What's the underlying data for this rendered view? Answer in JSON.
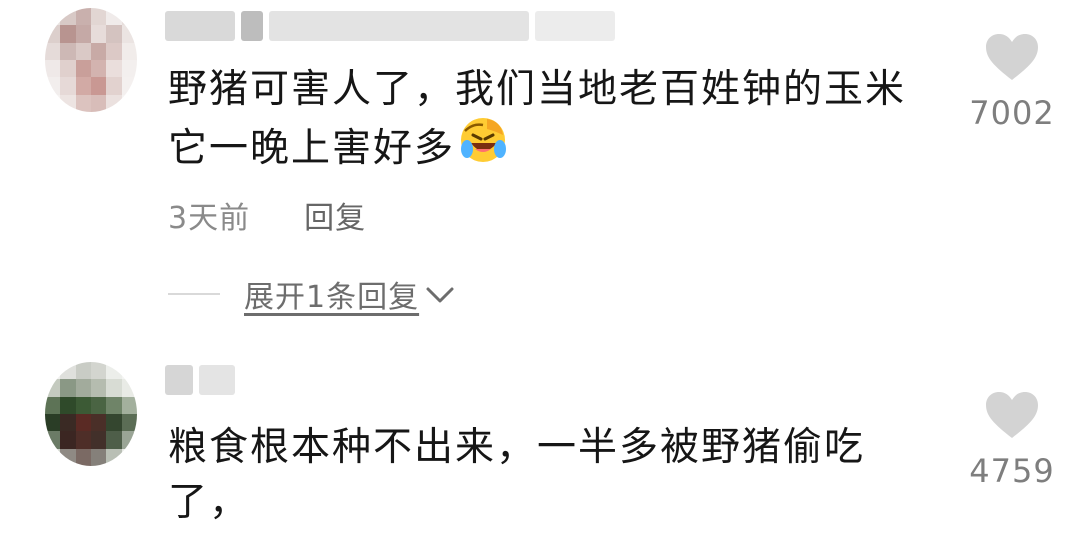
{
  "comments": [
    {
      "lines": [
        "野猪可害人了，我们当地老百姓钟的玉米",
        "它一晚上害好多"
      ],
      "emoji": "laughing-crying-emoji",
      "time": "3天前",
      "reply_label": "回复",
      "expand_label": "展开1条回复",
      "likes": "7002"
    },
    {
      "lines": [
        "粮食根本种不出来，一半多被野猪偷吃",
        "了，"
      ],
      "likes": "4759"
    }
  ],
  "icons": {
    "like": "heart-icon",
    "expand": "chevron-down-icon"
  },
  "colors": {
    "heart": "#d3d3d3",
    "meta": "#8a8a8a",
    "text": "#161616"
  }
}
